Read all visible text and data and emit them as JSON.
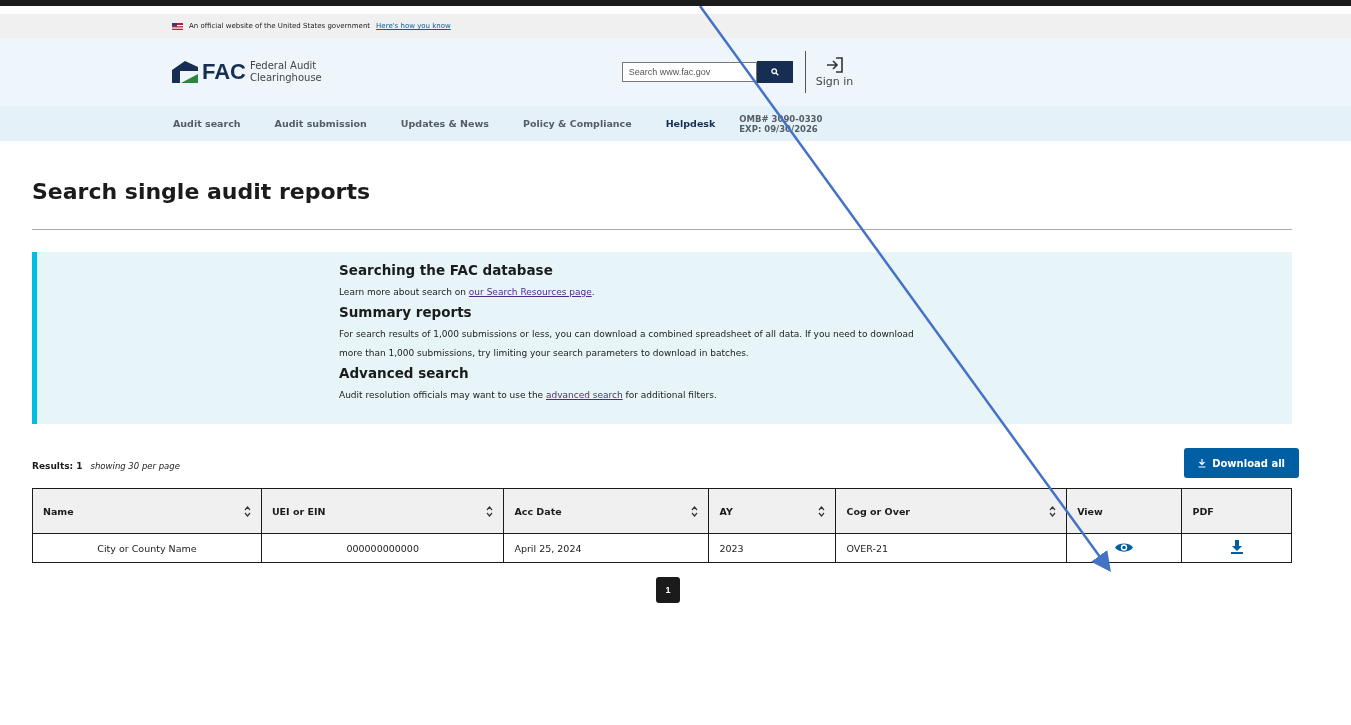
{
  "gov_banner": {
    "text": "An official website of the United States government",
    "link": "Here's how you know"
  },
  "header": {
    "logo": "FAC",
    "logo_subtitle": [
      "Federal Audit",
      "Clearinghouse"
    ],
    "search": {
      "placeholder": "Search www.fac.gov"
    },
    "sign_in": "Sign in"
  },
  "nav": {
    "items": [
      {
        "label": "Audit search",
        "kind": "link"
      },
      {
        "label": "Audit submission",
        "kind": "link"
      },
      {
        "label": "Updates & News",
        "kind": "link"
      },
      {
        "label": "Policy & Compliance",
        "kind": "link"
      },
      {
        "label": "Helpdesk",
        "kind": "highlight"
      }
    ],
    "omb": [
      "OMB# 3090-0330",
      "EXP: 09/30/2026"
    ]
  },
  "page_title": "Search single audit reports",
  "info": [
    {
      "heading": "Searching the FAC database",
      "lines": [
        [
          {
            "text": "Learn more about search on "
          },
          {
            "text": "our Search Resources page",
            "link": true
          },
          {
            "text": "."
          }
        ]
      ]
    },
    {
      "heading": "Summary reports",
      "lines": [
        [
          {
            "text": "For search results of 1,000 submissions or less, you can download a combined spreadsheet of all data. If you need to download"
          }
        ],
        [
          {
            "text": "more than 1,000 submissions, try limiting your search parameters to download in batches."
          }
        ]
      ]
    },
    {
      "heading": "Advanced search",
      "lines": [
        [
          {
            "text": "Audit resolution officials may want to use the "
          },
          {
            "text": "advanced search",
            "link": true
          },
          {
            "text": " for additional filters."
          }
        ]
      ]
    }
  ],
  "results": {
    "label": "Results: 1",
    "per_page": "showing 30 per page",
    "download_button": "Download all"
  },
  "table": {
    "columns": [
      {
        "label": "Name",
        "sortable": true
      },
      {
        "label": "UEI or EIN",
        "sortable": true
      },
      {
        "label": "Acc Date",
        "sortable": true
      },
      {
        "label": "AY",
        "sortable": true
      },
      {
        "label": "Cog or Over",
        "sortable": true
      },
      {
        "label": "View",
        "sortable": false
      },
      {
        "label": "PDF",
        "sortable": false
      }
    ],
    "rows": [
      {
        "name": "City or County Name",
        "uei": "000000000000",
        "acc_date": "April 25, 2024",
        "ay": "2023",
        "cog": "OVER-21"
      }
    ]
  },
  "pagination": [
    {
      "label": "1",
      "selected": true
    }
  ]
}
